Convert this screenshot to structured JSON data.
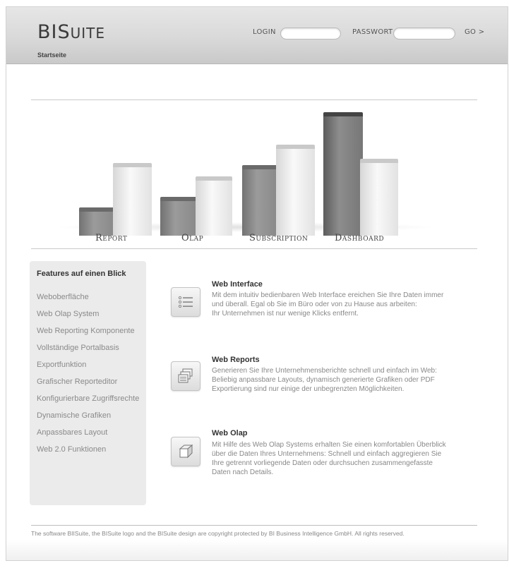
{
  "header": {
    "logo_big1": "BI",
    "logo_big2": "S",
    "logo_small": "UITE",
    "login_label": "LOGIN",
    "login_value": "",
    "password_label": "PASSWORT",
    "password_value": "",
    "go_label": "GO >"
  },
  "breadcrumb": "Startseite",
  "showcase": {
    "categories": [
      "Report",
      "Olap",
      "Subscription",
      "Dashboard"
    ]
  },
  "sidebar": {
    "title": "Features auf einen Blick",
    "items": [
      "Weboberfläche",
      "Web Olap System",
      "Web Reporting Komponente",
      "Vollständige Portalbasis",
      "Exportfunktion",
      "Grafischer Reporteditor",
      "Konfigurierbare Zugriffsrechte",
      "Dynamische Grafiken",
      "Anpassbares Layout",
      "Web 2.0 Funktionen"
    ]
  },
  "features": [
    {
      "icon": "list-icon",
      "title": "Web Interface",
      "lines": [
        "Mit dem intuitiv bedienbaren Web Interface ereichen Sie Ihre Daten immer",
        "und überall. Egal ob Sie im Büro oder von zu Hause aus arbeiten:",
        "Ihr Unternehmen ist nur wenige Klicks entfernt."
      ]
    },
    {
      "icon": "documents-icon",
      "title": "Web Reports",
      "lines": [
        "Generieren Sie Ihre Unternehmensberichte schnell und einfach im Web:",
        "Beliebig anpassbare Layouts, dynamisch generierte Grafiken oder PDF",
        "Exportierung sind nur einige der unbegrenzten Möglichkeiten."
      ]
    },
    {
      "icon": "cube-icon",
      "title": "Web Olap",
      "lines": [
        "Mit Hilfe des Web Olap Systems erhalten Sie einen komfortablen Überblick",
        "über die Daten Ihres Unternehmens: Schnell und einfach aggregieren Sie",
        "Ihre getrennt vorliegende Daten oder durchsuchen zusammengefasste",
        "Daten nach Details."
      ]
    }
  ],
  "footer": "The software BIISuite, the BISuite logo and the BISuite design are copyright protected by BI Business Intelligence GmbH. All rights reserved."
}
